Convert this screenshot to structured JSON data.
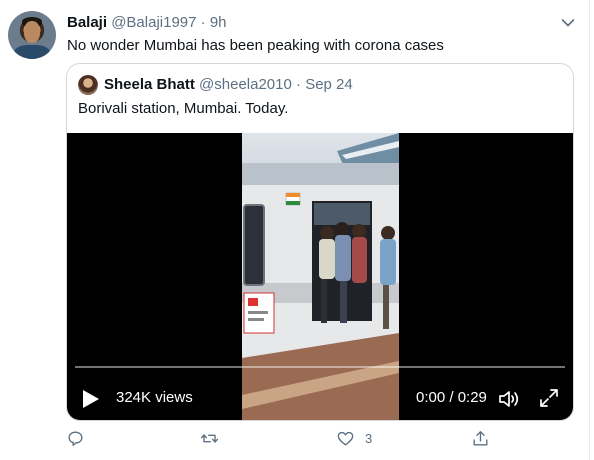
{
  "tweet": {
    "name": "Balaji",
    "handle": "@Balaji1997",
    "separator": "·",
    "time": "9h",
    "text": "No wonder Mumbai has been peaking with corona cases",
    "avatar_icon": "user-avatar",
    "more_icon": "chevron-down-icon"
  },
  "quoted": {
    "name": "Sheela Bhatt",
    "handle": "@sheela2010",
    "separator": "·",
    "date": "Sep 24",
    "text": "Borivali station, Mumbai. Today.",
    "video": {
      "views": "324K views",
      "time": "0:00 / 0:29",
      "progress": 0.0,
      "icons": [
        "play-icon",
        "volume-icon",
        "fullscreen-icon"
      ]
    }
  },
  "actions": {
    "reply_count": "",
    "retweet_count": "",
    "like_count": "3",
    "share_count": ""
  },
  "colors": {
    "secondary_text": "#5b7083",
    "border": "#cfd9de",
    "video_bg": "#000000"
  }
}
